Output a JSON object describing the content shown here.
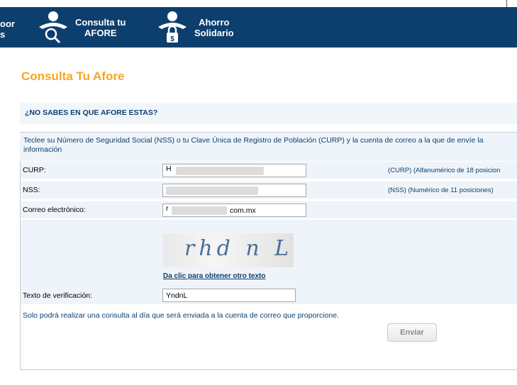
{
  "nav": {
    "cut_item": [
      "oor",
      "s"
    ],
    "items": [
      {
        "label_line1": "Consulta tu",
        "label_line2": "AFORE",
        "icon": "person-magnifier-icon"
      },
      {
        "label_line1": "Ahorro",
        "label_line2": "Solidario",
        "icon": "person-lock-icon"
      }
    ]
  },
  "page": {
    "title": "Consulta Tu Afore"
  },
  "section": {
    "heading": "¿NO SABES EN QUE AFORE ESTAS?"
  },
  "form": {
    "intro": "Teclee su Número de Seguridad Social (NSS) o tu Clave Única de Registro de Población (CURP) y la cuenta de correo a la que de envíe la información",
    "curp": {
      "label": "CURP:",
      "value": "H",
      "hint": "(CURP) (Alfanumérico de 18 posicion"
    },
    "nss": {
      "label": "NSS:",
      "value": "",
      "hint": "(NSS) (Numérico de 11 posiciones)"
    },
    "email": {
      "label": "Correo electrónico:",
      "value_start": "r",
      "value_end": "com.mx"
    },
    "captcha": {
      "text": "rhd n L",
      "refresh_link": "Da clic para obtener otro texto"
    },
    "verification": {
      "label": "Texto de verificación:",
      "value": "YndnL"
    },
    "note": "Solo podrá realizar una consulta al día que será enviada a la cuenta de correo que proporcione.",
    "submit_label": "Enviar"
  }
}
